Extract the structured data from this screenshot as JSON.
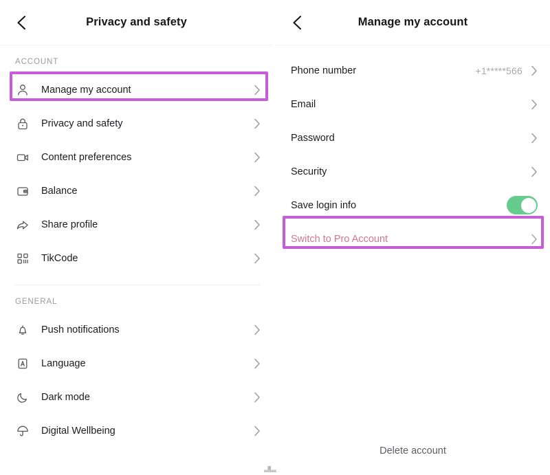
{
  "left_panel": {
    "header": {
      "title": "Privacy and safety",
      "back_icon": "chevron-left-icon"
    },
    "sections": [
      {
        "label": "ACCOUNT",
        "items": [
          {
            "label": "Manage my account",
            "icon": "person-icon",
            "highlighted": true
          },
          {
            "label": "Privacy and safety",
            "icon": "lock-icon",
            "highlighted": false
          },
          {
            "label": "Content preferences",
            "icon": "video-icon",
            "highlighted": false
          },
          {
            "label": "Balance",
            "icon": "wallet-icon",
            "highlighted": false
          },
          {
            "label": "Share profile",
            "icon": "share-icon",
            "highlighted": false
          },
          {
            "label": "TikCode",
            "icon": "qr-code-icon",
            "highlighted": false
          }
        ]
      },
      {
        "label": "GENERAL",
        "items": [
          {
            "label": "Push notifications",
            "icon": "bell-icon",
            "highlighted": false
          },
          {
            "label": "Language",
            "icon": "language-icon",
            "highlighted": false
          },
          {
            "label": "Dark mode",
            "icon": "moon-icon",
            "highlighted": false
          },
          {
            "label": "Digital Wellbeing",
            "icon": "umbrella-icon",
            "highlighted": false
          }
        ]
      }
    ]
  },
  "right_panel": {
    "header": {
      "title": "Manage my account",
      "back_icon": "chevron-left-icon"
    },
    "items": [
      {
        "label": "Phone number",
        "value": "+1*****566",
        "type": "link"
      },
      {
        "label": "Email",
        "value": "",
        "type": "link"
      },
      {
        "label": "Password",
        "value": "",
        "type": "link"
      },
      {
        "label": "Security",
        "value": "",
        "type": "link"
      },
      {
        "label": "Save login info",
        "value": "on",
        "type": "toggle"
      },
      {
        "label": "Switch to Pro Account",
        "value": "",
        "type": "link-accent"
      }
    ],
    "delete_account_label": "Delete account"
  },
  "colors": {
    "highlight_box": "#c65cd9",
    "toggle_on": "#66cc8e",
    "pro_account_text": "#d2778e",
    "title_text": "#17161a",
    "label_text": "#1c1b20",
    "muted_text": "#9a9a9f",
    "background": "#ffffff"
  }
}
